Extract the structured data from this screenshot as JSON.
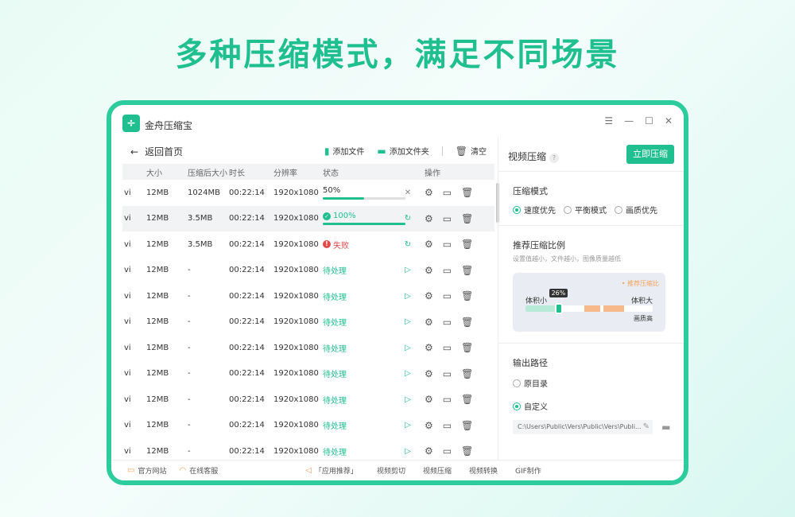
{
  "banner": {
    "headline": "多种压缩模式，满足不同场景"
  },
  "window": {
    "app_title": "金舟压缩宝",
    "logo_glyph": "÷"
  },
  "toolbar": {
    "back_label": "返回首页",
    "add_file": "添加文件",
    "add_folder": "添加文件夹",
    "clear": "清空"
  },
  "table": {
    "headers": [
      "大小",
      "压缩后大小",
      "时长",
      "分辨率",
      "状态",
      "操作"
    ],
    "rows": [
      {
        "name": "vi",
        "size": "12MB",
        "after": "1024MB",
        "duration": "00:22:14",
        "res": "1920x1080",
        "status": "50%",
        "kind": "progress",
        "progress": 0.5
      },
      {
        "name": "vi",
        "size": "12MB",
        "after": "3.5MB",
        "duration": "00:22:14",
        "res": "1920x1080",
        "status": "100%",
        "kind": "done",
        "progress": 1.0
      },
      {
        "name": "vi",
        "size": "12MB",
        "after": "3.5MB",
        "duration": "00:22:14",
        "res": "1920x1080",
        "status": "失败",
        "kind": "fail"
      },
      {
        "name": "vi",
        "size": "12MB",
        "after": "-",
        "duration": "00:22:14",
        "res": "1920x1080",
        "status": "待处理",
        "kind": "pending"
      },
      {
        "name": "vi",
        "size": "12MB",
        "after": "-",
        "duration": "00:22:14",
        "res": "1920x1080",
        "status": "待处理",
        "kind": "pending"
      },
      {
        "name": "vi",
        "size": "12MB",
        "after": "-",
        "duration": "00:22:14",
        "res": "1920x1080",
        "status": "待处理",
        "kind": "pending"
      },
      {
        "name": "vi",
        "size": "12MB",
        "after": "-",
        "duration": "00:22:14",
        "res": "1920x1080",
        "status": "待处理",
        "kind": "pending"
      },
      {
        "name": "vi",
        "size": "12MB",
        "after": "-",
        "duration": "00:22:14",
        "res": "1920x1080",
        "status": "待处理",
        "kind": "pending"
      },
      {
        "name": "vi",
        "size": "12MB",
        "after": "-",
        "duration": "00:22:14",
        "res": "1920x1080",
        "status": "待处理",
        "kind": "pending"
      },
      {
        "name": "vi",
        "size": "12MB",
        "after": "-",
        "duration": "00:22:14",
        "res": "1920x1080",
        "status": "待处理",
        "kind": "pending"
      },
      {
        "name": "vi",
        "size": "12MB",
        "after": "-",
        "duration": "00:22:14",
        "res": "1920x1080",
        "status": "待处理",
        "kind": "pending"
      }
    ]
  },
  "right": {
    "title": "视频压缩",
    "help": "?",
    "compress_button": "立即压缩",
    "mode_title": "压缩模式",
    "modes": [
      {
        "label": "速度优先",
        "selected": true
      },
      {
        "label": "平衡模式",
        "selected": false
      },
      {
        "label": "画质优先",
        "selected": false
      }
    ],
    "ratio_title": "推荐压缩比例",
    "ratio_sub": "设置值越小，文件越小，图像质量越低",
    "recommend_label": "• 推荐压缩比",
    "ratio_value": "26%",
    "ratio_fraction": 0.26,
    "small_label": "体积小",
    "large_label": "体积大",
    "quality_label": "画质高",
    "output_title": "输出路径",
    "outputs": [
      {
        "label": "原目录",
        "selected": false
      },
      {
        "label": "自定义",
        "selected": true
      }
    ],
    "path": "C:\\Users\\Public\\Vers\\Public\\Vers\\Publi..."
  },
  "footer": {
    "site": "官方网站",
    "service": "在线客服",
    "recommend": "「应用推荐」",
    "links": [
      "视频剪切",
      "视频压缩",
      "视频转换",
      "GIF制作"
    ]
  },
  "colors": {
    "accent": "#1fbf8f",
    "fail": "#e24a4a",
    "orange": "#f4a25a"
  }
}
